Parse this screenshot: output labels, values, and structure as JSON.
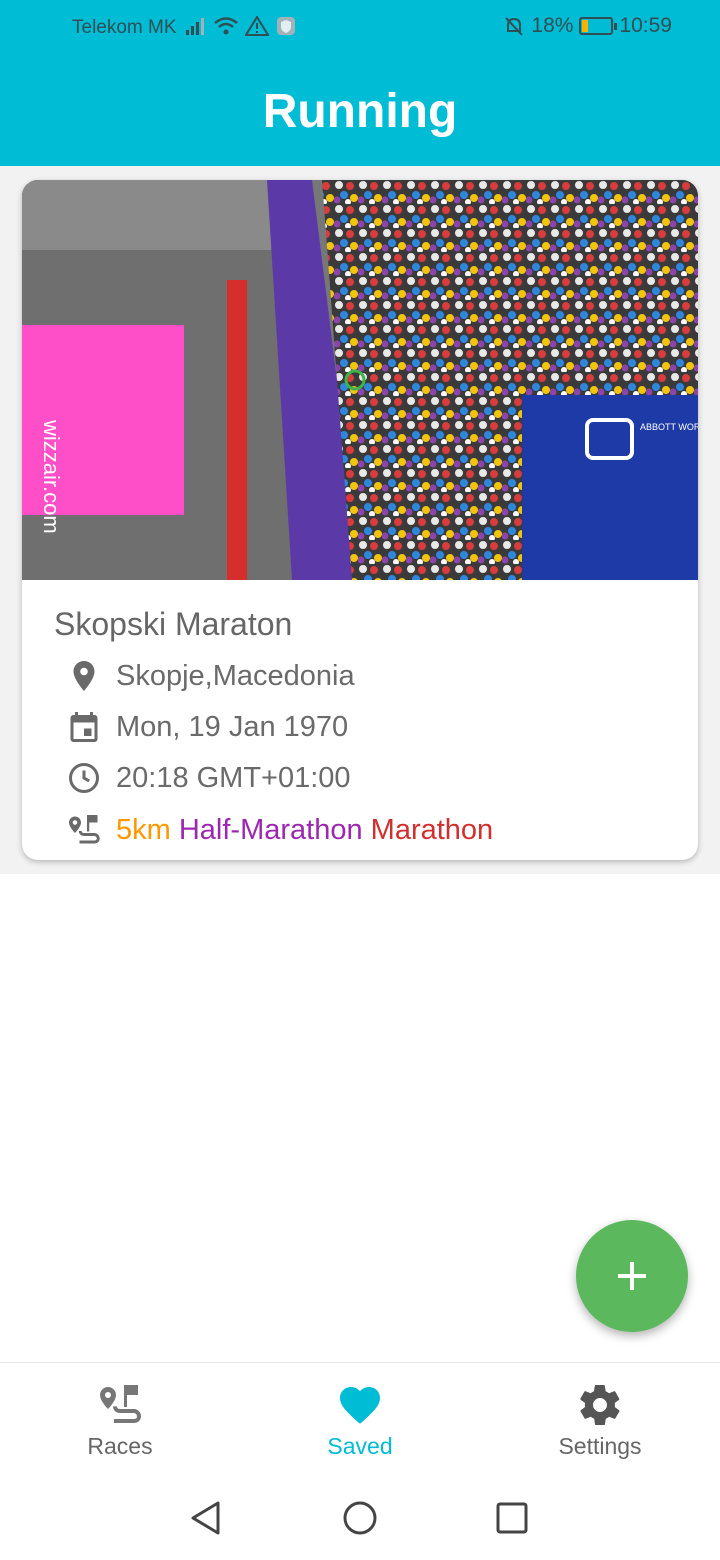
{
  "status_bar": {
    "carrier": "Telekom MK",
    "battery_percent": "18%",
    "battery_level": 0.18,
    "time": "10:59"
  },
  "header": {
    "title": "Running"
  },
  "race": {
    "name": "Skopski Maraton",
    "location": "Skopje,Macedonia",
    "date": "Mon, 19 Jan 1970",
    "time": "20:18 GMT+01:00",
    "distances": [
      "5km",
      "Half-Marathon",
      "Marathon"
    ],
    "image_banner_text": "wizzair.com",
    "image_sign_text": "ABBOTT WORLD MARATHON MAJORS"
  },
  "fab": {
    "icon": "plus-icon"
  },
  "bottom_nav": {
    "items": [
      {
        "label": "Races",
        "icon": "races-icon"
      },
      {
        "label": "Saved",
        "icon": "heart-icon"
      },
      {
        "label": "Settings",
        "icon": "gear-icon"
      }
    ],
    "active": "Saved"
  },
  "colors": {
    "primary": "#00BCD4",
    "fab": "#5CB85C",
    "distance_5k": "#FF9800",
    "distance_half": "#9C27B0",
    "distance_full": "#D32F2F"
  }
}
